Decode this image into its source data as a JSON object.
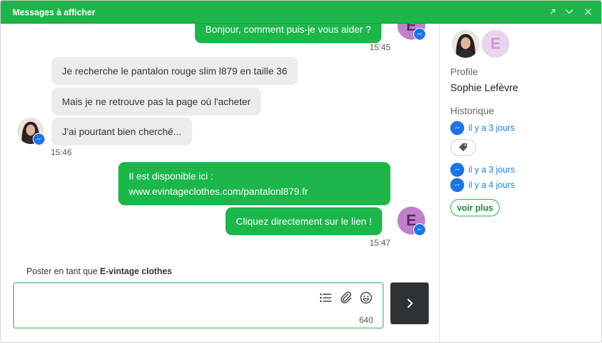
{
  "window": {
    "title": "Messages à afficher"
  },
  "chat": {
    "messages": [
      {
        "text": "Bonjour, comment puis-je vous aider ?"
      },
      {
        "text": "Je recherche le pantalon rouge slim l879 en taille 36"
      },
      {
        "text": "Mais je ne retrouve pas la page où l'acheter"
      },
      {
        "text": "J'ai pourtant bien cherché..."
      },
      {
        "line1": "Il est disponible ici :",
        "line2": "www.evintageclothes.com/pantalonl879.fr"
      },
      {
        "text": "Cliquez directement sur le lien !"
      }
    ],
    "times": [
      "15:45",
      "15:46",
      "15:47"
    ],
    "agent_avatar_letter": "E"
  },
  "composer": {
    "poster_prefix": "Poster en tant que",
    "poster_name": "E-vintage clothes",
    "placeholder": "",
    "counter": "640"
  },
  "sidebar": {
    "avatar_letter": "E",
    "profile_label": "Profile",
    "profile_name": "Sophie Lefèvre",
    "history_label": "Historique",
    "history": [
      {
        "when": "il y a 3 jours"
      },
      {
        "when": "il y a 3 jours"
      },
      {
        "when": "il y a 4 jours"
      }
    ],
    "more_label": "voir plus"
  },
  "colors": {
    "brand_green": "#1cb64b",
    "messenger_blue": "#1b74e4",
    "agent_avatar": "#c080c9",
    "send_button": "#2d3236"
  },
  "icons": [
    "expand-icon",
    "collapse-icon",
    "close-icon",
    "messenger-icon",
    "list-icon",
    "attach-icon",
    "emoji-icon",
    "send-chevron-icon",
    "tag-icon"
  ]
}
